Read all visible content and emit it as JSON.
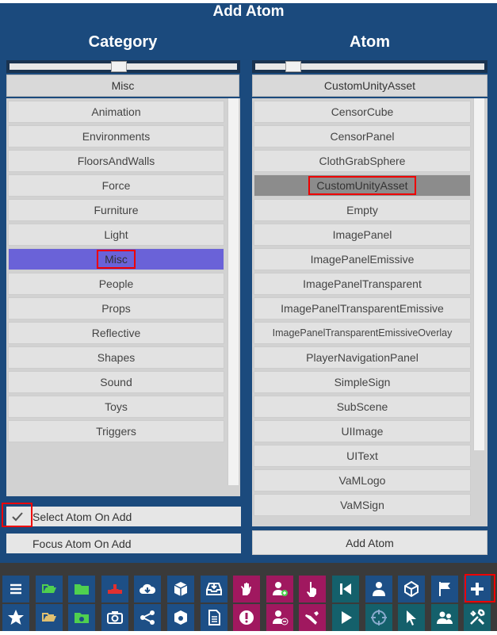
{
  "top_strip_text": "",
  "dialog": {
    "title": "Add Atom",
    "category_header": "Category",
    "atom_header": "Atom"
  },
  "category": {
    "selected": "Misc",
    "items": [
      "Animation",
      "Environments",
      "FloorsAndWalls",
      "Force",
      "Furniture",
      "Light",
      "Misc",
      "People",
      "Props",
      "Reflective",
      "Shapes",
      "Sound",
      "Toys",
      "Triggers"
    ]
  },
  "atom": {
    "selected": "CustomUnityAsset",
    "items": [
      "CensorCube",
      "CensorPanel",
      "ClothGrabSphere",
      "CustomUnityAsset",
      "Empty",
      "ImagePanel",
      "ImagePanelEmissive",
      "ImagePanelTransparent",
      "ImagePanelTransparentEmissive",
      "ImagePanelTransparentEmissiveOverlay",
      "PlayerNavigationPanel",
      "SimpleSign",
      "SubScene",
      "UIImage",
      "UIText",
      "VaMLogo",
      "VaMSign"
    ]
  },
  "options": {
    "select_on_add": {
      "label": "Select Atom On Add",
      "checked": true
    },
    "focus_on_add": {
      "label": "Focus Atom On Add",
      "checked": false
    }
  },
  "add_button_label": "Add Atom",
  "toolbar": {
    "row1": [
      {
        "name": "menu-icon",
        "bg": "#1d4f86"
      },
      {
        "name": "open-scene-icon",
        "bg": "#1d4f86"
      },
      {
        "name": "folder-icon",
        "bg": "#1d4f86"
      },
      {
        "name": "save-scene-icon",
        "bg": "#1d4f86"
      },
      {
        "name": "cloud-download-icon",
        "bg": "#1d4f86"
      },
      {
        "name": "package-icon",
        "bg": "#1d4f86"
      },
      {
        "name": "inbox-icon",
        "bg": "#1d4f86"
      },
      {
        "name": "hand-icon",
        "bg": "#a0185f"
      },
      {
        "name": "add-person-icon",
        "bg": "#a0185f"
      },
      {
        "name": "pointer-hand-icon",
        "bg": "#a0185f"
      },
      {
        "name": "skip-back-icon",
        "bg": "#14606b"
      },
      {
        "name": "person-icon",
        "bg": "#1d4f86"
      },
      {
        "name": "unity-icon",
        "bg": "#1d4f86"
      },
      {
        "name": "flag-icon",
        "bg": "#1d4f86"
      },
      {
        "name": "add-atom-icon",
        "bg": "#1d4f86"
      }
    ],
    "row2": [
      {
        "name": "star-icon",
        "bg": "#1d4f86"
      },
      {
        "name": "save-icon",
        "bg": "#1d4f86"
      },
      {
        "name": "folder-settings-icon",
        "bg": "#1d4f86"
      },
      {
        "name": "camera-icon",
        "bg": "#1d4f86"
      },
      {
        "name": "share-icon",
        "bg": "#1d4f86"
      },
      {
        "name": "package-settings-icon",
        "bg": "#1d4f86"
      },
      {
        "name": "document-icon",
        "bg": "#1d4f86"
      },
      {
        "name": "alert-icon",
        "bg": "#a0185f"
      },
      {
        "name": "remove-person-icon",
        "bg": "#a0185f"
      },
      {
        "name": "grab-icon",
        "bg": "#a0185f"
      },
      {
        "name": "play-icon",
        "bg": "#14606b"
      },
      {
        "name": "target-icon",
        "bg": "#14606b"
      },
      {
        "name": "cursor-icon",
        "bg": "#14606b"
      },
      {
        "name": "people-icon",
        "bg": "#14606b"
      },
      {
        "name": "tools-icon",
        "bg": "#14606b"
      }
    ]
  }
}
